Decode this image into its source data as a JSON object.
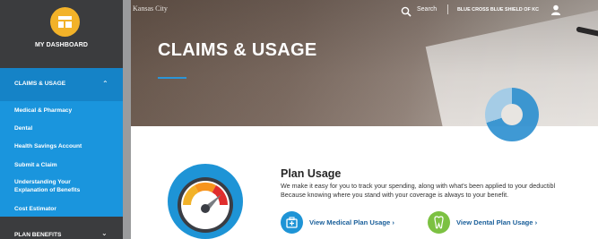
{
  "sidebar": {
    "dashboard_label": "MY DASHBOARD",
    "claims_section_label": "CLAIMS & USAGE",
    "claims_items": [
      {
        "label": "Medical & Pharmacy"
      },
      {
        "label": "Dental"
      },
      {
        "label": "Health Savings Account"
      },
      {
        "label": "Submit a Claim"
      },
      {
        "label": "Understanding Your"
      },
      {
        "label": "Explanation of Benefits"
      },
      {
        "label": "Cost Estimator"
      }
    ],
    "plan_benefits_label": "PLAN BENEFITS",
    "colors": {
      "dark": "#3c3d40",
      "active": "#1583c7",
      "submenu": "#1a95dd",
      "icon_bg": "#f2b229"
    }
  },
  "header": {
    "brand_text": "Kansas City",
    "search_label": "Search",
    "org_label": "BLUE CROSS BLUE SHIELD OF KC"
  },
  "hero": {
    "title": "CLAIMS & USAGE"
  },
  "plan_usage": {
    "title": "Plan Usage",
    "description_line1": "We make it easy for you to track your spending, along with what's been applied to your deductibl",
    "description_line2": "Because knowing where you stand with your coverage is always to your benefit.",
    "medical_link": "View Medical Plan Usage",
    "dental_link": "View Dental Plan Usage",
    "link_chevron": "›",
    "colors": {
      "medical_icon": "#1e94d6",
      "dental_icon": "#7cc142"
    }
  },
  "icons": {
    "dashboard": "dashboard-grid-icon",
    "search": "search-icon",
    "user": "user-icon",
    "gauge": "gauge-icon",
    "medical": "medical-bag-icon",
    "dental": "tooth-icon"
  }
}
